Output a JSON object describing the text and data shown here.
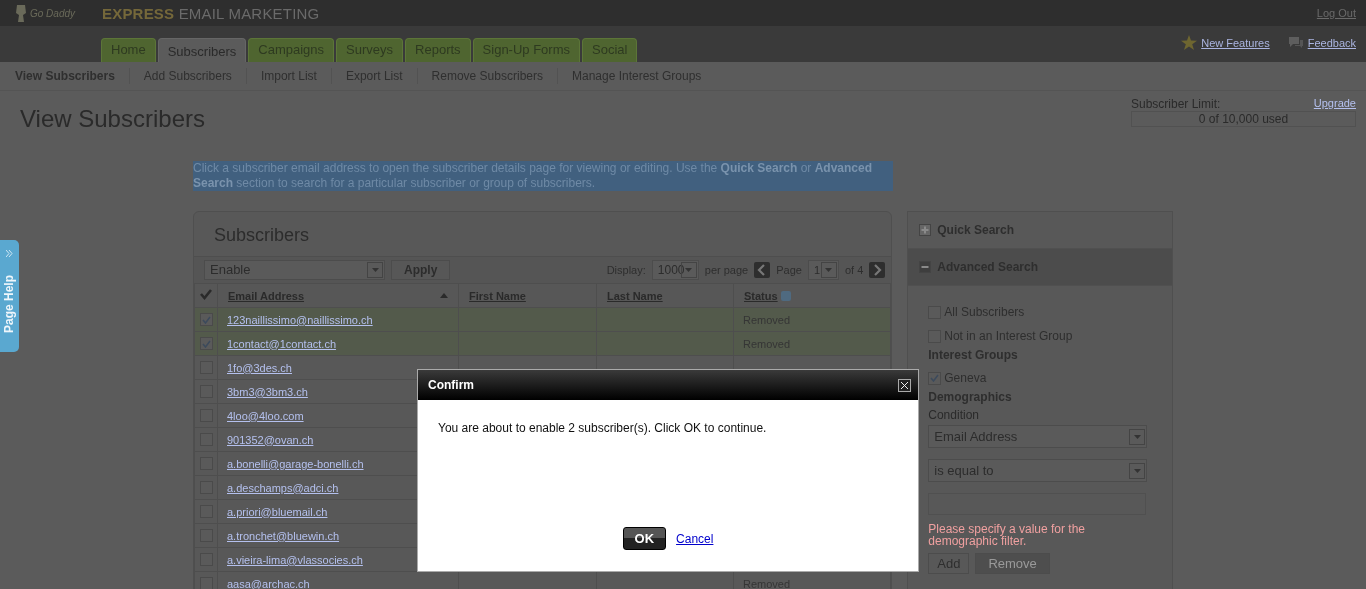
{
  "brand": {
    "logo": "Go Daddy",
    "product_accent": "EXPRESS",
    "product": "EMAIL MARKETING",
    "logout": "Log Out"
  },
  "tabs": [
    {
      "label": "Home",
      "selected": false
    },
    {
      "label": "Subscribers",
      "selected": true
    },
    {
      "label": "Campaigns",
      "selected": false
    },
    {
      "label": "Surveys",
      "selected": false
    },
    {
      "label": "Reports",
      "selected": false
    },
    {
      "label": "Sign-Up Forms",
      "selected": false
    },
    {
      "label": "Social",
      "selected": false
    }
  ],
  "top_links": [
    {
      "kind": "star",
      "label": "New Features"
    },
    {
      "kind": "chat",
      "label": "Feedback"
    }
  ],
  "subnav": [
    {
      "label": "View Subscribers",
      "selected": true
    },
    {
      "label": "Add Subscribers",
      "selected": false
    },
    {
      "label": "Import List",
      "selected": false
    },
    {
      "label": "Export List",
      "selected": false
    },
    {
      "label": "Remove Subscribers",
      "selected": false
    },
    {
      "label": "Manage Interest Groups",
      "selected": false
    }
  ],
  "page_title": "View Subscribers",
  "limit": {
    "label": "Subscriber Limit:",
    "upgrade": "Upgrade",
    "usage": "0 of 10,000 used"
  },
  "intro": {
    "text": "Click a subscriber email address to open the subscriber details page for viewing or editing. Use the **Quick Search** or **Advanced Search** section to search for a particular subscriber or group of subscribers.",
    "highlighted": true
  },
  "page_help": {
    "label": "Page Help"
  },
  "subscribers": {
    "title": "Subscribers",
    "action": "Enable",
    "apply": "Apply",
    "display_label": "Display:",
    "display_value": "1000",
    "per_page": "per page",
    "page_label": "Page",
    "page_value": "1",
    "page_of": "of 4",
    "columns": [
      "Email Address",
      "First Name",
      "Last Name",
      "Status"
    ],
    "rows": [
      {
        "email": "123naillissimo@naillissimo.ch",
        "checked": true,
        "status": "Removed"
      },
      {
        "email": "1contact@1contact.ch",
        "checked": true,
        "status": "Removed"
      },
      {
        "email": "1fo@3des.ch",
        "checked": false
      },
      {
        "email": "3bm3@3bm3.ch",
        "checked": false
      },
      {
        "email": "4loo@4loo.com",
        "checked": false
      },
      {
        "email": "901352@ovan.ch",
        "checked": false
      },
      {
        "email": "a.bonelli@garage-bonelli.ch",
        "checked": false
      },
      {
        "email": "a.deschamps@adci.ch",
        "checked": false
      },
      {
        "email": "a.priori@bluemail.ch",
        "checked": false
      },
      {
        "email": "a.tronchet@bluewin.ch",
        "checked": false
      },
      {
        "email": "a.vieira-lima@vlassocies.ch",
        "checked": false
      },
      {
        "email": "aasa@archac.ch",
        "checked": false,
        "status": "Removed"
      }
    ]
  },
  "search": {
    "sections": [
      {
        "title": "Quick Search",
        "expanded": false
      },
      {
        "title": "Advanced Search",
        "expanded": true
      }
    ],
    "options": [
      {
        "label": "All Subscribers",
        "checked": false
      },
      {
        "label": "Not in an Interest Group",
        "checked": false
      }
    ],
    "groups_heading": "Interest Groups",
    "groups": [
      {
        "label": "Geneva",
        "checked": true
      }
    ],
    "demographics_heading": "Demographics",
    "condition_label": "Condition",
    "field": "Email Address",
    "operator": "is equal to",
    "error": "Please specify a value for the demographic filter.",
    "add": "Add",
    "remove": "Remove",
    "remove_disabled": true
  },
  "dialog": {
    "title": "Confirm",
    "message": "You are about to enable 2 subscriber(s). Click OK to continue.",
    "ok": "OK",
    "cancel": "Cancel"
  }
}
